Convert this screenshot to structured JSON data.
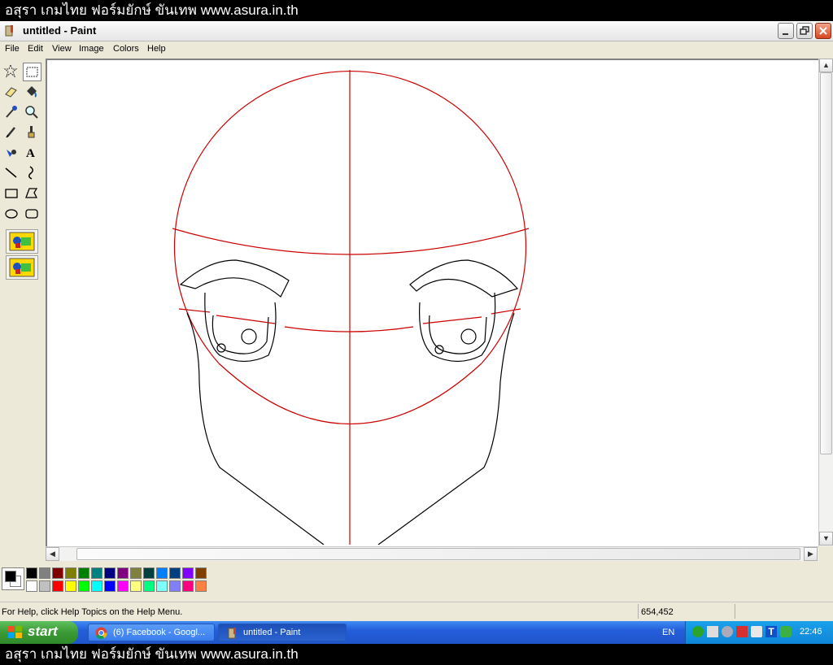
{
  "banner": {
    "text": "อสุรา เกมไทย ฟอร์มยักษ์ ขันเทพ www.asura.in.th"
  },
  "window": {
    "title": "untitled - Paint"
  },
  "menu": [
    "File",
    "Edit",
    "View",
    "Image",
    "Colors",
    "Help"
  ],
  "tools": [
    "free-form-select",
    "rectangle-select",
    "eraser",
    "fill-with-color",
    "pick-color",
    "magnifier",
    "pencil",
    "brush",
    "airbrush",
    "text",
    "line",
    "curve",
    "rectangle",
    "polygon",
    "ellipse",
    "rounded-rectangle"
  ],
  "selected_tool": "rectangle-select",
  "palette": {
    "foreground": "#000000",
    "background": "#ffffff",
    "row1": [
      "#000000",
      "#808080",
      "#800000",
      "#808000",
      "#008000",
      "#008080",
      "#000080",
      "#800080",
      "#808040",
      "#004040",
      "#0080ff",
      "#004080",
      "#8000ff",
      "#804000"
    ],
    "row2": [
      "#ffffff",
      "#c0c0c0",
      "#ff0000",
      "#ffff00",
      "#00ff00",
      "#00ffff",
      "#0000ff",
      "#ff00ff",
      "#ffff80",
      "#00ff80",
      "#80ffff",
      "#8080ff",
      "#ff0080",
      "#ff8040"
    ]
  },
  "status": {
    "help": "For Help, click Help Topics on the Help Menu.",
    "coords": "654,452"
  },
  "taskbar": {
    "start": "start",
    "tasks": [
      {
        "label": "(6) Facebook - Googl...",
        "icon": "chrome-icon"
      },
      {
        "label": "untitled - Paint",
        "icon": "paint-icon"
      }
    ],
    "language": "EN",
    "clock": "22:46"
  },
  "colors": {
    "guide_lines": "#cc0000",
    "ink": "#000000",
    "taskbar": "#245edb",
    "start": "#3a9a34"
  }
}
